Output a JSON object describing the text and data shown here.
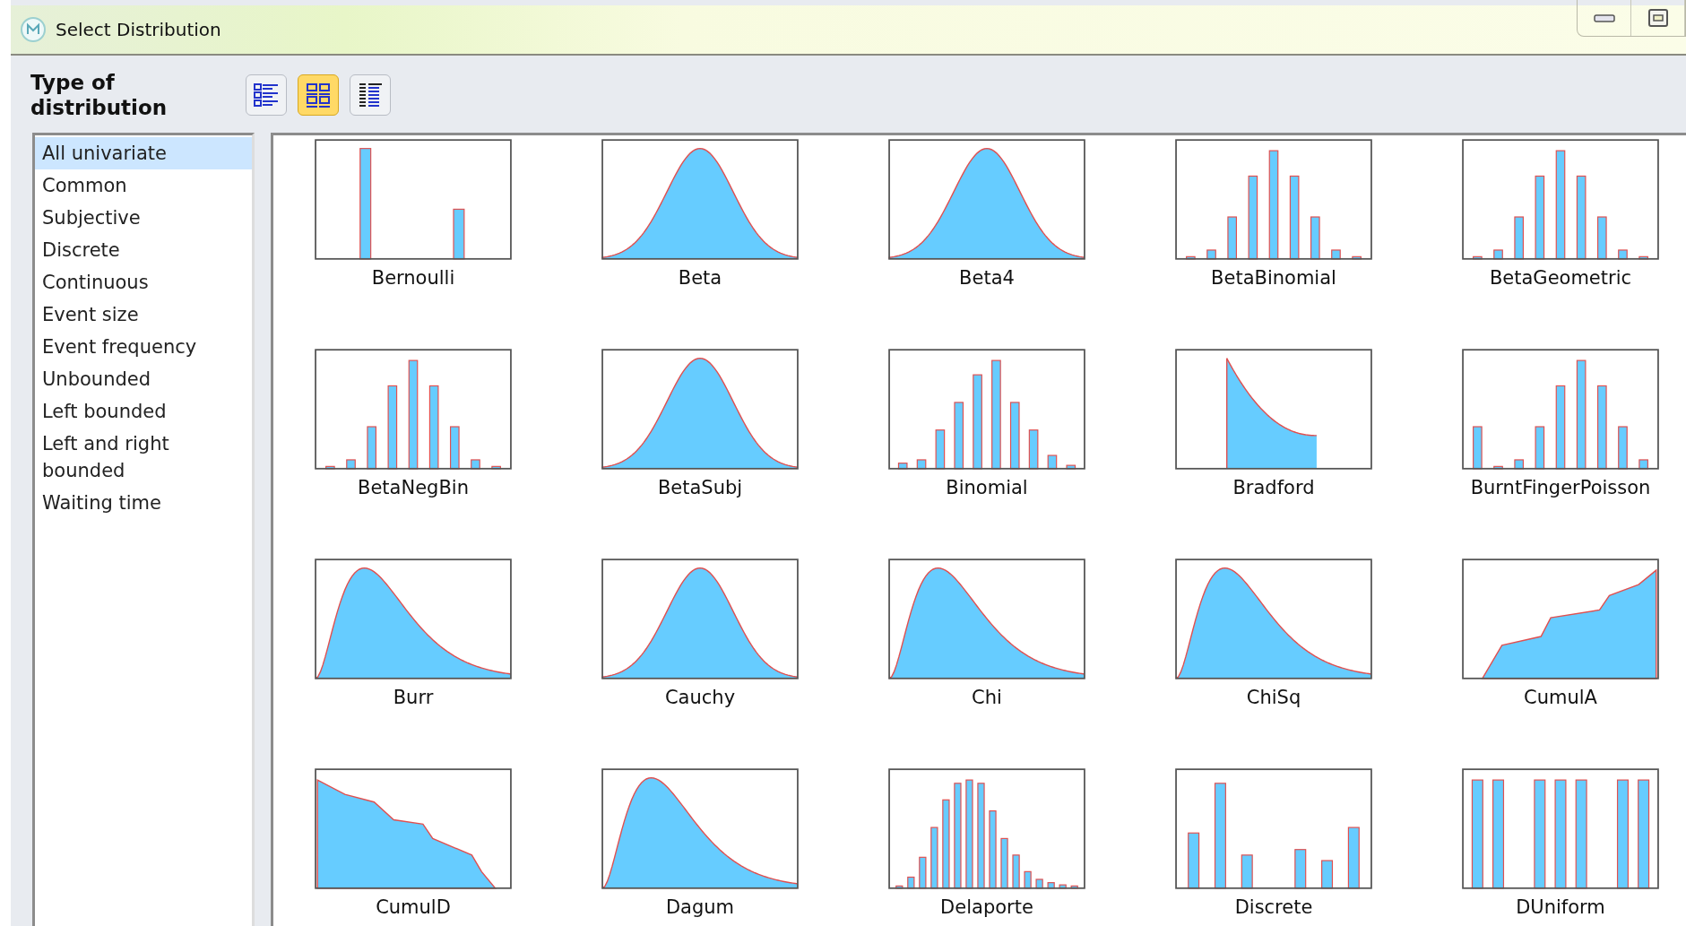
{
  "window": {
    "title": "Select Distribution"
  },
  "header": "Type of distribution",
  "view_buttons": [
    {
      "selected": false
    },
    {
      "selected": true
    },
    {
      "selected": false
    }
  ],
  "categories": [
    {
      "label": "All univariate",
      "selected": true
    },
    {
      "label": "Common",
      "selected": false
    },
    {
      "label": "Subjective",
      "selected": false
    },
    {
      "label": "Discrete",
      "selected": false
    },
    {
      "label": "Continuous",
      "selected": false
    },
    {
      "label": "Event size",
      "selected": false
    },
    {
      "label": "Event frequency",
      "selected": false
    },
    {
      "label": "Unbounded",
      "selected": false
    },
    {
      "label": "Left bounded",
      "selected": false
    },
    {
      "label": "Left and right bounded",
      "selected": false
    },
    {
      "label": "Waiting time",
      "selected": false
    }
  ],
  "distributions": [
    {
      "name": "Bernoulli",
      "kind": "bernoulli"
    },
    {
      "name": "Beta",
      "kind": "bell"
    },
    {
      "name": "Beta4",
      "kind": "bell"
    },
    {
      "name": "BetaBinomial",
      "kind": "binomial"
    },
    {
      "name": "BetaGeometric",
      "kind": "binomial"
    },
    {
      "name": "BetaNegBin",
      "kind": "binomial"
    },
    {
      "name": "BetaSubj",
      "kind": "bell"
    },
    {
      "name": "Binomial",
      "kind": "binomial-skew"
    },
    {
      "name": "Bradford",
      "kind": "bradford"
    },
    {
      "name": "BurntFingerPoisson",
      "kind": "burnt"
    },
    {
      "name": "Burr",
      "kind": "skew"
    },
    {
      "name": "Cauchy",
      "kind": "bell"
    },
    {
      "name": "Chi",
      "kind": "skew"
    },
    {
      "name": "ChiSq",
      "kind": "skew"
    },
    {
      "name": "CumulA",
      "kind": "cumul-up"
    },
    {
      "name": "CumulD",
      "kind": "cumul-down"
    },
    {
      "name": "Dagum",
      "kind": "skew"
    },
    {
      "name": "Delaporte",
      "kind": "delaporte"
    },
    {
      "name": "Discrete",
      "kind": "discrete"
    },
    {
      "name": "DUniform",
      "kind": "uniform"
    }
  ]
}
